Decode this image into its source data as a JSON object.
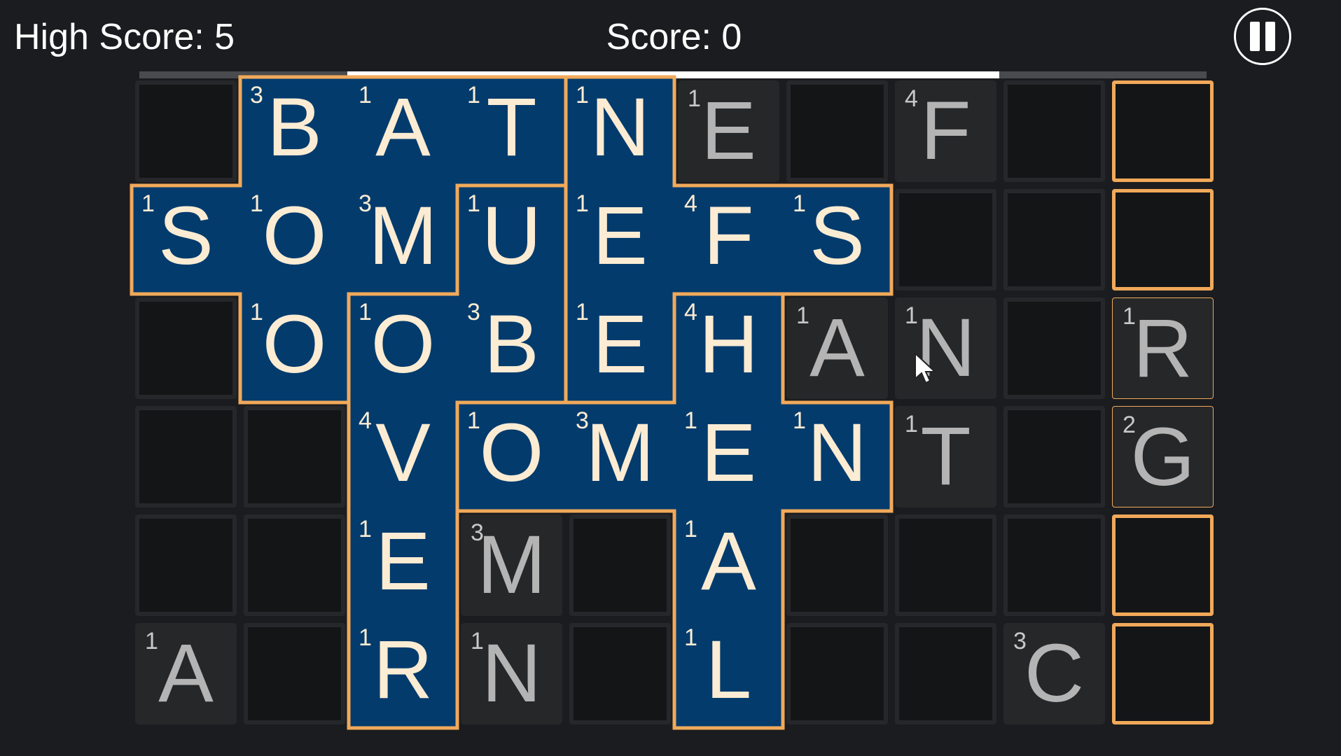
{
  "hud": {
    "high_score_text": "High Score: 5",
    "score_text": "Score: 0",
    "pause_icon": "pause-icon",
    "timer_fraction_start": 0.195,
    "timer_fraction_end": 0.806
  },
  "colors": {
    "background": "#1b1c1f",
    "word_fill": "#033b6d",
    "outline": "#f1a95a",
    "tile": "#262729"
  },
  "board": {
    "columns": 10,
    "rows": 6,
    "cells": [
      [
        {
          "t": "empty"
        },
        {
          "t": "word",
          "l": "B",
          "p": "3"
        },
        {
          "t": "word",
          "l": "A",
          "p": "1"
        },
        {
          "t": "word",
          "l": "T",
          "p": "1"
        },
        {
          "t": "word",
          "l": "N",
          "p": "1"
        },
        {
          "t": "tile",
          "l": "E",
          "p": "1"
        },
        {
          "t": "empty"
        },
        {
          "t": "tile",
          "l": "F",
          "p": "4"
        },
        {
          "t": "empty"
        },
        {
          "t": "slot"
        }
      ],
      [
        {
          "t": "word",
          "l": "S",
          "p": "1"
        },
        {
          "t": "word",
          "l": "O",
          "p": "1"
        },
        {
          "t": "word",
          "l": "M",
          "p": "3"
        },
        {
          "t": "word",
          "l": "U",
          "p": "1"
        },
        {
          "t": "word",
          "l": "E",
          "p": "1"
        },
        {
          "t": "word",
          "l": "F",
          "p": "4"
        },
        {
          "t": "word",
          "l": "S",
          "p": "1"
        },
        {
          "t": "empty"
        },
        {
          "t": "empty"
        },
        {
          "t": "slot"
        }
      ],
      [
        {
          "t": "empty"
        },
        {
          "t": "word",
          "l": "O",
          "p": "1"
        },
        {
          "t": "word",
          "l": "O",
          "p": "1"
        },
        {
          "t": "word",
          "l": "B",
          "p": "3"
        },
        {
          "t": "word",
          "l": "E",
          "p": "1"
        },
        {
          "t": "word",
          "l": "H",
          "p": "4"
        },
        {
          "t": "tile",
          "l": "A",
          "p": "1"
        },
        {
          "t": "tile",
          "l": "N",
          "p": "1"
        },
        {
          "t": "empty"
        },
        {
          "t": "slot-filled",
          "l": "R",
          "p": "1"
        }
      ],
      [
        {
          "t": "empty"
        },
        {
          "t": "empty"
        },
        {
          "t": "word",
          "l": "V",
          "p": "4"
        },
        {
          "t": "word",
          "l": "O",
          "p": "1"
        },
        {
          "t": "word",
          "l": "M",
          "p": "3"
        },
        {
          "t": "word",
          "l": "E",
          "p": "1"
        },
        {
          "t": "word",
          "l": "N",
          "p": "1"
        },
        {
          "t": "tile",
          "l": "T",
          "p": "1"
        },
        {
          "t": "empty"
        },
        {
          "t": "slot-filled",
          "l": "G",
          "p": "2"
        }
      ],
      [
        {
          "t": "empty"
        },
        {
          "t": "empty"
        },
        {
          "t": "word",
          "l": "E",
          "p": "1"
        },
        {
          "t": "tile",
          "l": "M",
          "p": "3"
        },
        {
          "t": "empty"
        },
        {
          "t": "word",
          "l": "A",
          "p": "1"
        },
        {
          "t": "empty"
        },
        {
          "t": "empty"
        },
        {
          "t": "empty"
        },
        {
          "t": "slot"
        }
      ],
      [
        {
          "t": "tile",
          "l": "A",
          "p": "1"
        },
        {
          "t": "empty"
        },
        {
          "t": "word",
          "l": "R",
          "p": "1"
        },
        {
          "t": "tile",
          "l": "N",
          "p": "1"
        },
        {
          "t": "empty"
        },
        {
          "t": "word",
          "l": "L",
          "p": "1"
        },
        {
          "t": "empty"
        },
        {
          "t": "empty"
        },
        {
          "t": "tile",
          "l": "C",
          "p": "3"
        },
        {
          "t": "slot"
        }
      ]
    ],
    "word_groups": [
      [
        [
          0,
          1
        ],
        [
          0,
          2
        ],
        [
          0,
          3
        ],
        [
          1,
          0
        ],
        [
          1,
          1
        ],
        [
          1,
          2
        ],
        [
          2,
          1
        ]
      ],
      [
        [
          1,
          3
        ],
        [
          2,
          2
        ],
        [
          2,
          3
        ],
        [
          3,
          2
        ],
        [
          4,
          2
        ],
        [
          5,
          2
        ]
      ],
      [
        [
          0,
          4
        ],
        [
          1,
          4
        ],
        [
          1,
          5
        ],
        [
          1,
          6
        ],
        [
          2,
          4
        ]
      ],
      [
        [
          2,
          5
        ],
        [
          3,
          3
        ],
        [
          3,
          4
        ],
        [
          3,
          5
        ],
        [
          3,
          6
        ],
        [
          4,
          5
        ],
        [
          5,
          5
        ]
      ]
    ]
  }
}
